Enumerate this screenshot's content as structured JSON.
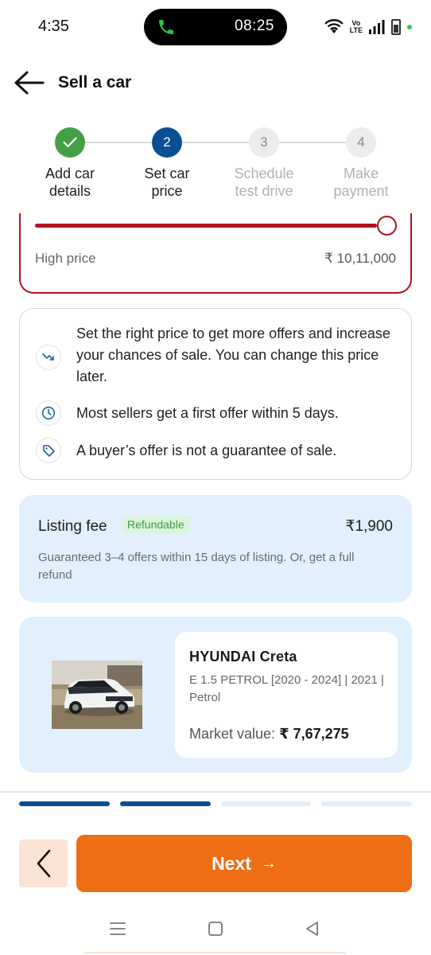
{
  "status_bar": {
    "time": "4:35",
    "call_timer": "08:25",
    "volte_top": "Vo",
    "volte_bottom": "LTE",
    "icons": [
      "phone-icon",
      "wifi-icon",
      "volte-icon",
      "signal-icon",
      "battery-icon"
    ]
  },
  "header": {
    "title": "Sell a car",
    "back_icon": "arrow-left-icon"
  },
  "stepper": {
    "steps": [
      {
        "number": "1",
        "label_1": "Add car",
        "label_2": "details",
        "state": "done"
      },
      {
        "number": "2",
        "label_1": "Set car",
        "label_2": "price",
        "state": "active"
      },
      {
        "number": "3",
        "label_1": "Schedule",
        "label_2": "test drive",
        "state": "pending"
      },
      {
        "number": "4",
        "label_1": "Make",
        "label_2": "payment",
        "state": "pending"
      }
    ]
  },
  "price_card": {
    "slider_level": 1.0,
    "high_label": "High price",
    "high_value": "₹ 10,11,000"
  },
  "info": {
    "items": [
      {
        "icon": "trend-down-icon",
        "text": "Set the right price to get more offers and increase your chances of sale. You can change this price later."
      },
      {
        "icon": "clock-icon",
        "text": "Most sellers get a first offer within 5 days."
      },
      {
        "icon": "tag-icon",
        "text": "A buyer’s offer is not a guarantee of sale."
      }
    ]
  },
  "listing_fee": {
    "title": "Listing fee",
    "badge": "Refundable",
    "amount": "₹1,900",
    "description": "Guaranteed 3–4 offers within 15 days of listing. Or, get a full refund"
  },
  "car": {
    "name": "HYUNDAI Creta",
    "variant": "E 1.5 PETROL [2020 - 2024] | 2021 | Petrol",
    "market_label": "Market value:",
    "market_value": "₹ 7,67,275"
  },
  "progress": {
    "segments_completed": 2,
    "segments_total": 4
  },
  "footer": {
    "next_label": "Next",
    "next_arrow": "→"
  },
  "colors": {
    "accent_orange": "#ef6e15",
    "primary_blue": "#0b4f93",
    "success_green": "#43a047",
    "warning_red": "#b0121d",
    "card_blue": "#e1f0fc"
  }
}
